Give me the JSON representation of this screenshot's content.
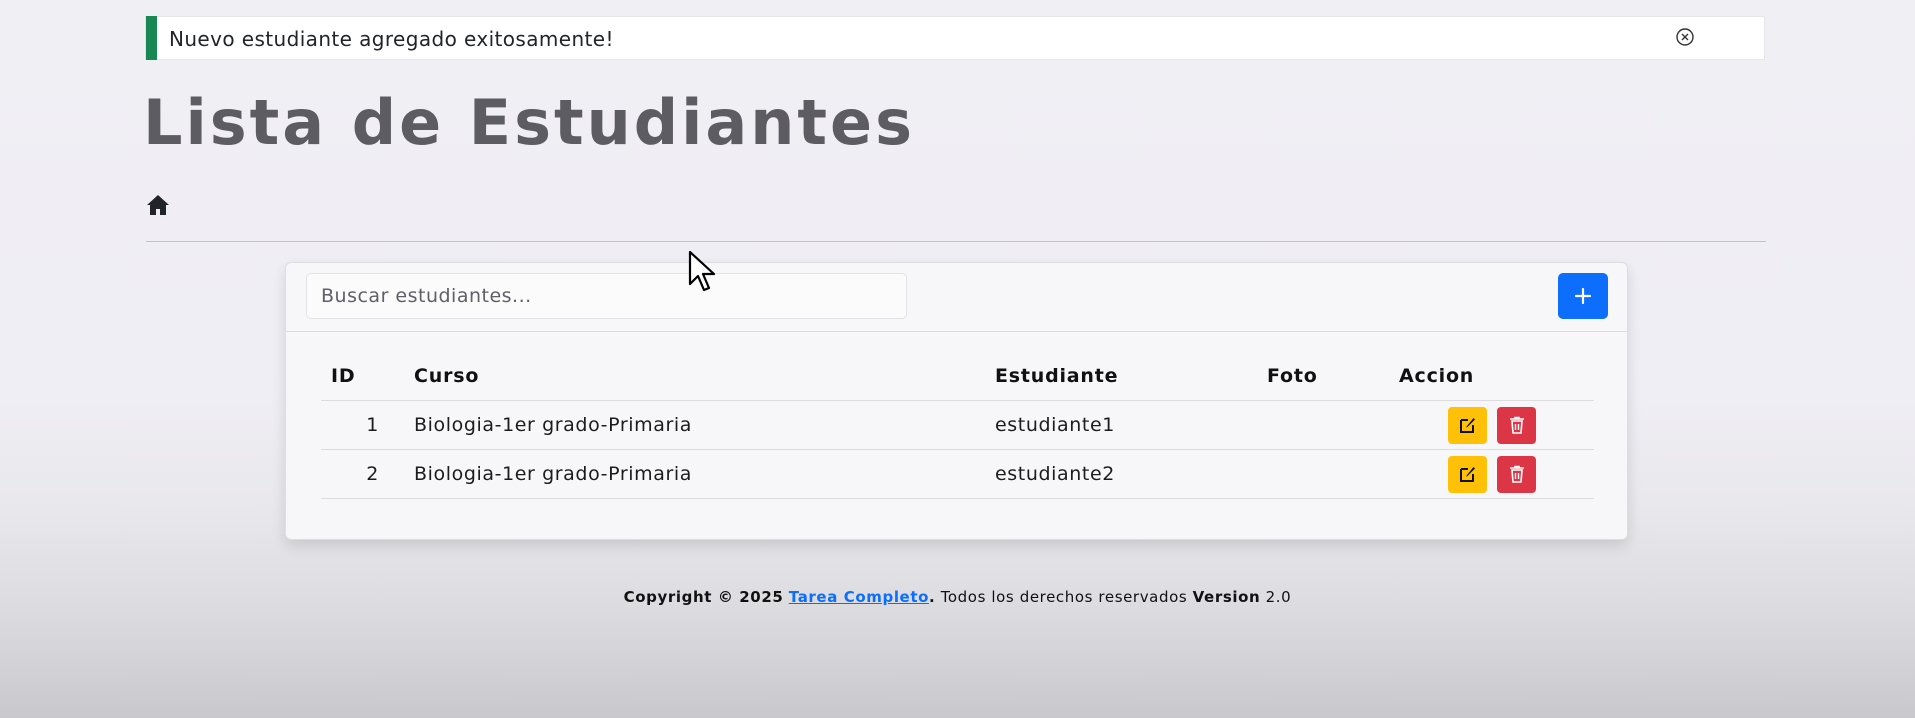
{
  "alert": {
    "message": "Nuevo estudiante agregado exitosamente!",
    "close_icon": "close-circle-icon",
    "accent_color": "#198754"
  },
  "page": {
    "title": "Lista de Estudiantes",
    "home_icon": "home-icon"
  },
  "search": {
    "placeholder": "Buscar estudiantes...",
    "value": ""
  },
  "add_button": {
    "icon": "plus-icon",
    "color": "#0d6efd"
  },
  "table": {
    "headers": {
      "id": "ID",
      "curso": "Curso",
      "estudiante": "Estudiante",
      "foto": "Foto",
      "accion": "Accion"
    },
    "rows": [
      {
        "id": "1",
        "curso": "Biologia-1er grado-Primaria",
        "estudiante": "estudiante1",
        "foto": ""
      },
      {
        "id": "2",
        "curso": "Biologia-1er grado-Primaria",
        "estudiante": "estudiante2",
        "foto": ""
      }
    ],
    "edit_icon": "edit-icon",
    "edit_color": "#ffc107",
    "delete_icon": "trash-icon",
    "delete_color": "#dc3545"
  },
  "footer": {
    "copyright": "Copyright © 2025",
    "link_text": "Tarea Completo",
    "rights": ". Todos los derechos reservados",
    "version_label": "Version",
    "version_value": "2.0"
  }
}
